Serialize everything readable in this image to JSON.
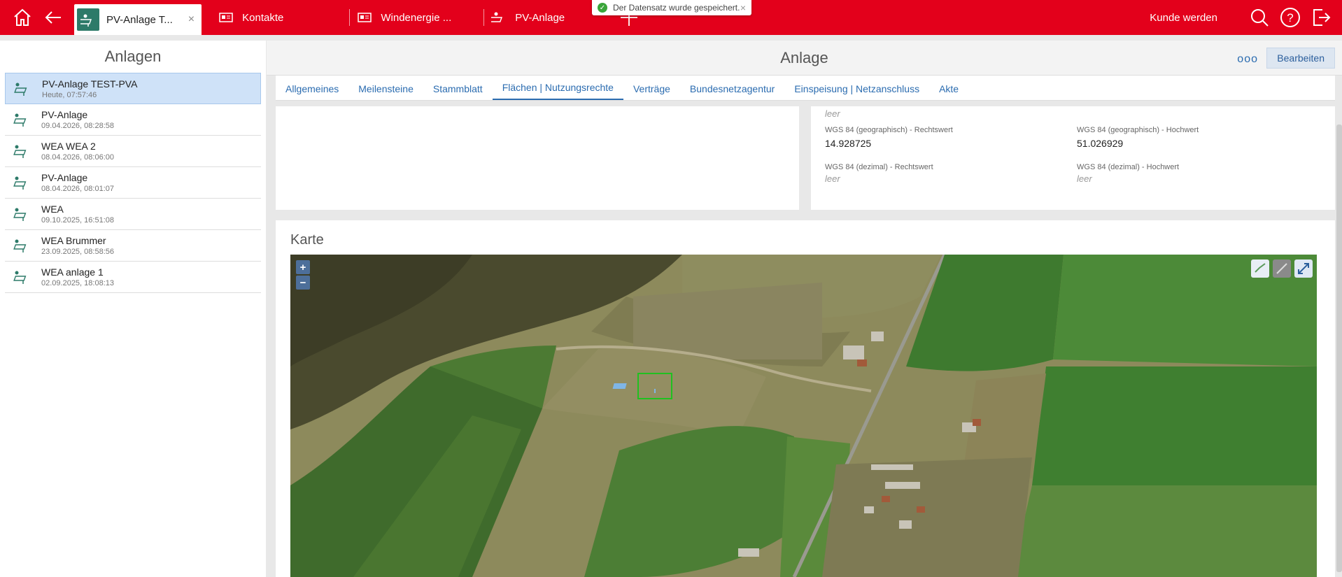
{
  "topbar": {
    "tabs": [
      {
        "label": "PV-Anlage T...",
        "active": true
      },
      {
        "label": "Kontakte"
      },
      {
        "label": "Windenergie ..."
      },
      {
        "label": "PV-Anlage"
      }
    ],
    "kunde_label": "Kunde werden",
    "close_glyph": "×"
  },
  "toast": {
    "message": "Der Datensatz wurde gespeichert."
  },
  "left": {
    "title": "Anlagen",
    "items": [
      {
        "title": "PV-Anlage TEST-PVA",
        "sub": "Heute, 07:57:46"
      },
      {
        "title": "PV-Anlage",
        "sub": "09.04.2026, 08:28:58"
      },
      {
        "title": "WEA WEA 2",
        "sub": "08.04.2026, 08:06:00"
      },
      {
        "title": "PV-Anlage",
        "sub": "08.04.2026, 08:01:07"
      },
      {
        "title": "WEA",
        "sub": "09.10.2025, 16:51:08"
      },
      {
        "title": "WEA Brummer",
        "sub": "23.09.2025, 08:58:56"
      },
      {
        "title": "WEA anlage 1",
        "sub": "02.09.2025, 18:08:13"
      }
    ]
  },
  "main": {
    "title": "Anlage",
    "more_label": "ooo",
    "edit_label": "Bearbeiten",
    "tabs": [
      "Allgemeines",
      "Meilensteine",
      "Stammblatt",
      "Flächen | Nutzungsrechte",
      "Verträge",
      "Bundesnetzagentur",
      "Einspeisung | Netzanschluss",
      "Akte"
    ],
    "active_tab": "Flächen | Nutzungsrechte",
    "fields": {
      "top_empty": "leer",
      "geo_rechts_label": "WGS 84 (geographisch) - Rechtswert",
      "geo_rechts_value": "14.928725",
      "geo_hoch_label": "WGS 84 (geographisch) - Hochwert",
      "geo_hoch_value": "51.026929",
      "dez_rechts_label": "WGS 84 (dezimal) - Rechtswert",
      "dez_rechts_value": "leer",
      "dez_hoch_label": "WGS 84 (dezimal) - Hochwert",
      "dez_hoch_value": "leer"
    },
    "map": {
      "title": "Karte",
      "zoom_in": "+",
      "zoom_out": "−"
    }
  },
  "colors": {
    "brand_red": "#e3001b",
    "link_blue": "#2b6cb0",
    "selected_bg": "#cfe2f8"
  }
}
